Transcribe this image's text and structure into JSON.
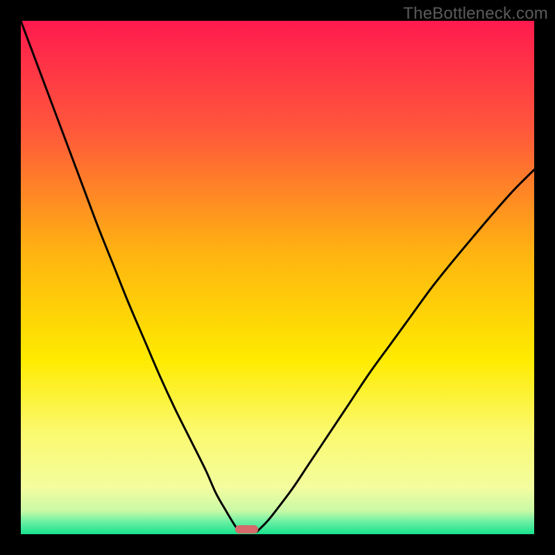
{
  "watermark": "TheBottleneck.com",
  "chart_data": {
    "type": "line",
    "title": "",
    "xlabel": "",
    "ylabel": "",
    "xlim": [
      0,
      100
    ],
    "ylim": [
      0,
      100
    ],
    "grid": false,
    "background_gradient_stops": [
      {
        "offset": 0.0,
        "color": "#ff1a4e"
      },
      {
        "offset": 0.22,
        "color": "#ff5a3a"
      },
      {
        "offset": 0.45,
        "color": "#ffb311"
      },
      {
        "offset": 0.66,
        "color": "#feeb00"
      },
      {
        "offset": 0.8,
        "color": "#fbf96e"
      },
      {
        "offset": 0.91,
        "color": "#f3fd9f"
      },
      {
        "offset": 0.955,
        "color": "#c8f9a6"
      },
      {
        "offset": 0.975,
        "color": "#6ef0a3"
      },
      {
        "offset": 1.0,
        "color": "#18e28e"
      }
    ],
    "series": [
      {
        "name": "left-curve",
        "x": [
          0.0,
          3.0,
          6.0,
          9.0,
          12.0,
          15.0,
          18.0,
          21.0,
          24.0,
          27.0,
          30.0,
          33.0,
          36.0,
          38.0,
          40.0,
          41.5,
          42.5
        ],
        "y": [
          100.0,
          92.0,
          84.0,
          76.0,
          68.0,
          60.0,
          52.5,
          45.0,
          38.0,
          31.0,
          24.5,
          18.5,
          12.5,
          8.0,
          4.5,
          2.0,
          0.5
        ]
      },
      {
        "name": "right-curve",
        "x": [
          46.0,
          48.0,
          50.0,
          53.0,
          56.0,
          60.0,
          64.0,
          68.0,
          72.0,
          76.0,
          80.0,
          84.0,
          88.0,
          92.0,
          96.0,
          100.0
        ],
        "y": [
          0.5,
          2.5,
          5.0,
          9.0,
          13.5,
          19.5,
          25.5,
          31.5,
          37.0,
          42.5,
          48.0,
          53.0,
          57.8,
          62.5,
          67.0,
          71.0
        ]
      }
    ],
    "valley_marker": {
      "name": "valley-marker",
      "x_center": 44.0,
      "width": 4.5,
      "y": 0.0,
      "color": "#d66a6a"
    }
  }
}
